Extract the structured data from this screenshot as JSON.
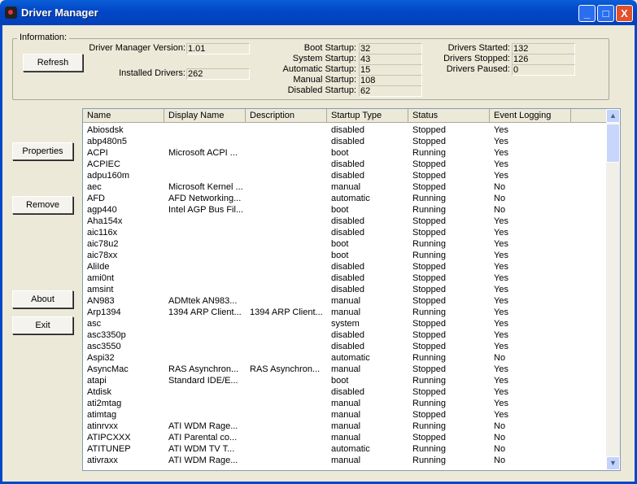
{
  "window": {
    "title": "Driver Manager",
    "minimize": "_",
    "maximize": "□",
    "close": "X"
  },
  "info": {
    "group_label": "Information:",
    "version_label": "Driver Manager Version:",
    "version": "1.01",
    "installed_label": "Installed Drivers:",
    "installed": "262",
    "startup": [
      {
        "label": "Boot Startup:",
        "value": "32"
      },
      {
        "label": "System Startup:",
        "value": "43"
      },
      {
        "label": "Automatic Startup:",
        "value": "15"
      },
      {
        "label": "Manual Startup:",
        "value": "108"
      },
      {
        "label": "Disabled Startup:",
        "value": "62"
      }
    ],
    "status": [
      {
        "label": "Drivers Started:",
        "value": "132"
      },
      {
        "label": "Drivers Stopped:",
        "value": "126"
      },
      {
        "label": "Drivers Paused:",
        "value": "0"
      }
    ]
  },
  "buttons": {
    "refresh": "Refresh",
    "properties": "Properties",
    "remove": "Remove",
    "about": "About",
    "exit": "Exit"
  },
  "columns": [
    "Name",
    "Display Name",
    "Description",
    "Startup Type",
    "Status",
    "Event Logging"
  ],
  "rows": [
    [
      "Abiosdsk",
      "",
      "",
      "disabled",
      "Stopped",
      "Yes"
    ],
    [
      "abp480n5",
      "",
      "",
      "disabled",
      "Stopped",
      "Yes"
    ],
    [
      "ACPI",
      "Microsoft ACPI ...",
      "",
      "boot",
      "Running",
      "Yes"
    ],
    [
      "ACPIEC",
      "",
      "",
      "disabled",
      "Stopped",
      "Yes"
    ],
    [
      "adpu160m",
      "",
      "",
      "disabled",
      "Stopped",
      "Yes"
    ],
    [
      "aec",
      "Microsoft Kernel ...",
      "",
      "manual",
      "Stopped",
      "No"
    ],
    [
      "AFD",
      "AFD Networking...",
      "",
      "automatic",
      "Running",
      "No"
    ],
    [
      "agp440",
      "Intel AGP Bus Fil...",
      "",
      "boot",
      "Running",
      "No"
    ],
    [
      "Aha154x",
      "",
      "",
      "disabled",
      "Stopped",
      "Yes"
    ],
    [
      "aic116x",
      "",
      "",
      "disabled",
      "Stopped",
      "Yes"
    ],
    [
      "aic78u2",
      "",
      "",
      "boot",
      "Running",
      "Yes"
    ],
    [
      "aic78xx",
      "",
      "",
      "boot",
      "Running",
      "Yes"
    ],
    [
      "AliIde",
      "",
      "",
      "disabled",
      "Stopped",
      "Yes"
    ],
    [
      "ami0nt",
      "",
      "",
      "disabled",
      "Stopped",
      "Yes"
    ],
    [
      "amsint",
      "",
      "",
      "disabled",
      "Stopped",
      "Yes"
    ],
    [
      "AN983",
      "ADMtek AN983...",
      "",
      "manual",
      "Stopped",
      "Yes"
    ],
    [
      "Arp1394",
      "1394 ARP Client...",
      "1394 ARP Client...",
      "manual",
      "Running",
      "Yes"
    ],
    [
      "asc",
      "",
      "",
      "system",
      "Stopped",
      "Yes"
    ],
    [
      "asc3350p",
      "",
      "",
      "disabled",
      "Stopped",
      "Yes"
    ],
    [
      "asc3550",
      "",
      "",
      "disabled",
      "Stopped",
      "Yes"
    ],
    [
      "Aspi32",
      "",
      "",
      "automatic",
      "Running",
      "No"
    ],
    [
      "AsyncMac",
      "RAS Asynchron...",
      "RAS Asynchron...",
      "manual",
      "Stopped",
      "Yes"
    ],
    [
      "atapi",
      "Standard IDE/E...",
      "",
      "boot",
      "Running",
      "Yes"
    ],
    [
      "Atdisk",
      "",
      "",
      "disabled",
      "Stopped",
      "Yes"
    ],
    [
      "ati2mtag",
      "",
      "",
      "manual",
      "Running",
      "Yes"
    ],
    [
      "atimtag",
      "",
      "",
      "manual",
      "Stopped",
      "Yes"
    ],
    [
      "atinrvxx",
      "ATI WDM Rage...",
      "",
      "manual",
      "Running",
      "No"
    ],
    [
      "ATIPCXXX",
      "ATI Parental co...",
      "",
      "manual",
      "Stopped",
      "No"
    ],
    [
      "ATITUNEP",
      "ATI WDM TV T...",
      "",
      "automatic",
      "Running",
      "No"
    ],
    [
      "ativraxx",
      "ATI WDM Rage...",
      "",
      "manual",
      "Running",
      "No"
    ]
  ]
}
